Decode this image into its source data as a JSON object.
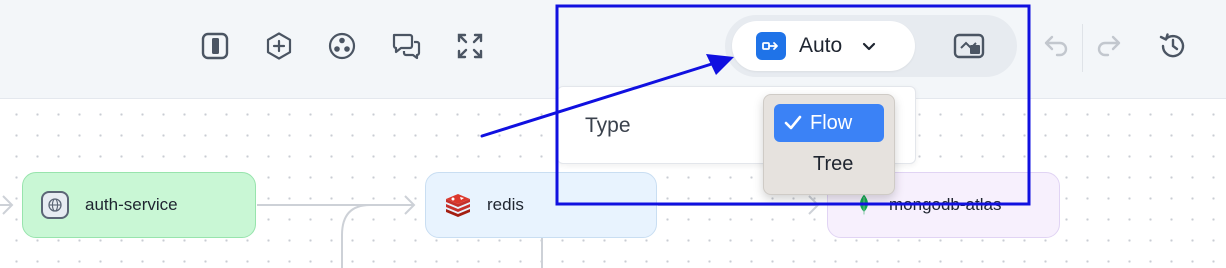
{
  "toolbar": {
    "icons": [
      "sidebar-toggle-icon",
      "add-node-icon",
      "cluster-icon",
      "comments-icon",
      "fullscreen-icon"
    ],
    "layout_mode": {
      "label": "Auto",
      "icon": "auto-layout-icon"
    },
    "map_icon": "minimap-icon",
    "history": [
      "undo-icon",
      "redo-icon",
      "history-icon"
    ]
  },
  "type_panel": {
    "label": "Type",
    "options": [
      {
        "label": "Flow",
        "selected": true
      },
      {
        "label": "Tree",
        "selected": false
      }
    ]
  },
  "nodes": [
    {
      "label": "auth-service",
      "icon": "globe-icon",
      "color": "#c9f7d5"
    },
    {
      "label": "redis",
      "icon": "redis-icon",
      "color": "#e8f3fe"
    },
    {
      "label": "mongodb-atlas",
      "icon": "mongodb-leaf-icon",
      "color": "#f7f0fd"
    }
  ],
  "annotation": {
    "color": "#1010e0"
  }
}
